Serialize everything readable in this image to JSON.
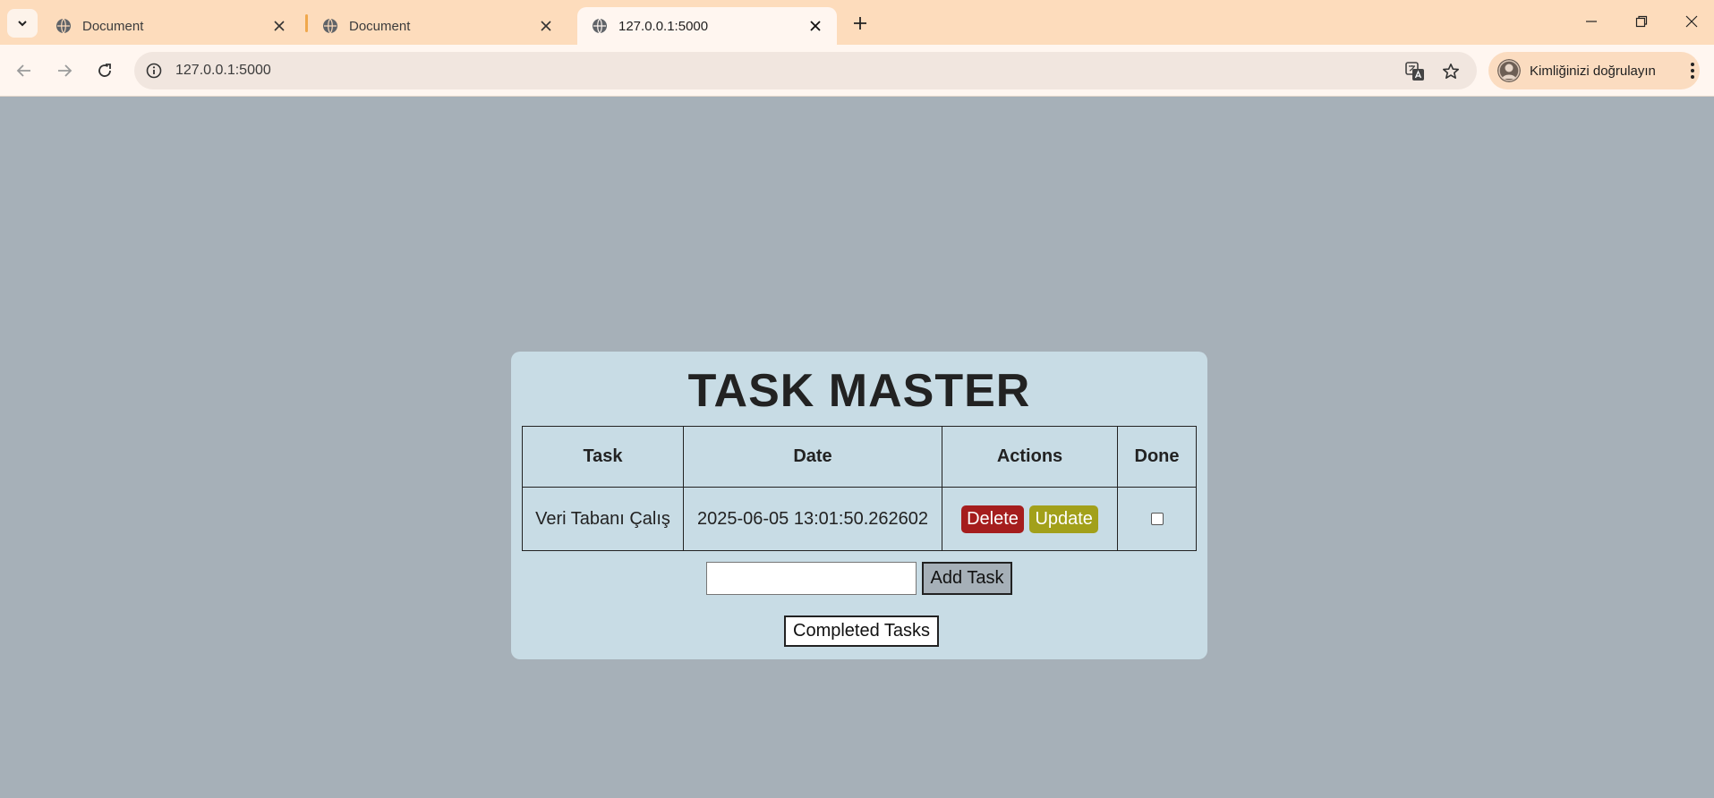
{
  "browser": {
    "tabs": [
      {
        "title": "Document",
        "active": false
      },
      {
        "title": "Document",
        "active": false
      },
      {
        "title": "127.0.0.1:5000",
        "active": true
      }
    ],
    "address": "127.0.0.1:5000",
    "profile_label": "Kimliğinizi doğrulayın",
    "colors": {
      "tabbar": "#fddcbc",
      "toolbar": "#fff6f0",
      "omnibox": "#f1e6df",
      "profile_chip": "#fbdcc0"
    }
  },
  "page": {
    "title": "TASK MASTER",
    "colors": {
      "background": "#a6b0b8",
      "card": "#c8dce5",
      "delete": "#a51d1d",
      "update": "#a2a01a"
    },
    "table": {
      "headers": [
        "Task",
        "Date",
        "Actions",
        "Done"
      ],
      "rows": [
        {
          "task": "Veri Tabanı Çalış",
          "date": "2025-06-05 13:01:50.262602",
          "delete_label": "Delete",
          "update_label": "Update",
          "done": false
        }
      ]
    },
    "add_task": {
      "input_value": "",
      "button_label": "Add Task"
    },
    "completed_button_label": "Completed Tasks"
  }
}
